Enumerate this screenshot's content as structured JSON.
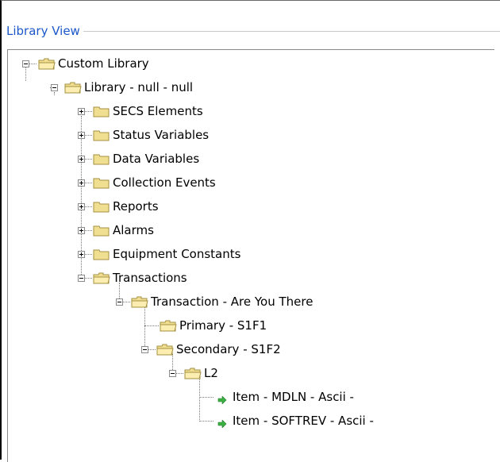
{
  "panel": {
    "title": "Library View"
  },
  "tree": {
    "root": "Custom Library",
    "library": "Library - null - null",
    "categories": [
      "SECS Elements",
      "Status Variables",
      "Data Variables",
      "Collection Events",
      "Reports",
      "Alarms",
      "Equipment Constants"
    ],
    "transactions": "Transactions",
    "transaction": "Transaction - Are You There",
    "primary": "Primary - S1F1",
    "secondary": "Secondary - S1F2",
    "list": "L2",
    "items": [
      "Item - MDLN - Ascii -",
      "Item - SOFTREV - Ascii -"
    ]
  },
  "colors": {
    "title": "#1c57c9",
    "folder": "#f1df91",
    "arrow": "#3cb043"
  }
}
